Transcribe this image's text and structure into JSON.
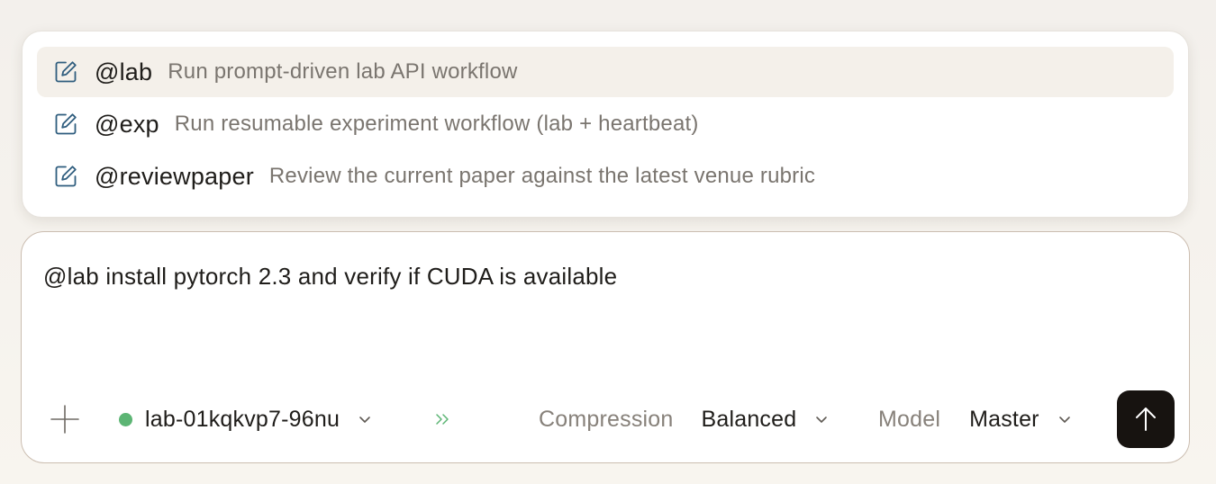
{
  "suggestions": [
    {
      "command": "@lab",
      "description": "Run prompt-driven lab API workflow",
      "icon": "edit-icon"
    },
    {
      "command": "@exp",
      "description": "Run resumable experiment workflow (lab + heartbeat)",
      "icon": "edit-icon"
    },
    {
      "command": "@reviewpaper",
      "description": "Review the current paper against the latest venue rubric",
      "icon": "edit-icon"
    }
  ],
  "composer": {
    "prompt": "@lab install pytorch 2.3 and verify if CUDA is available"
  },
  "toolbar": {
    "add_icon": "plus-icon",
    "environment": {
      "label": "lab-01kqkvp7-96nu",
      "status": "online",
      "status_color": "#5cb574"
    },
    "forward_icon": "double-chevron-right-icon",
    "compression": {
      "label": "Compression",
      "value": "Balanced"
    },
    "model": {
      "label": "Model",
      "value": "Master"
    },
    "send_icon": "arrow-up-icon"
  },
  "colors": {
    "icon_blue": "#2f5d7e",
    "active_row": "#f4f0ea",
    "send_button": "#171310",
    "forward_green": "#5cb574"
  }
}
